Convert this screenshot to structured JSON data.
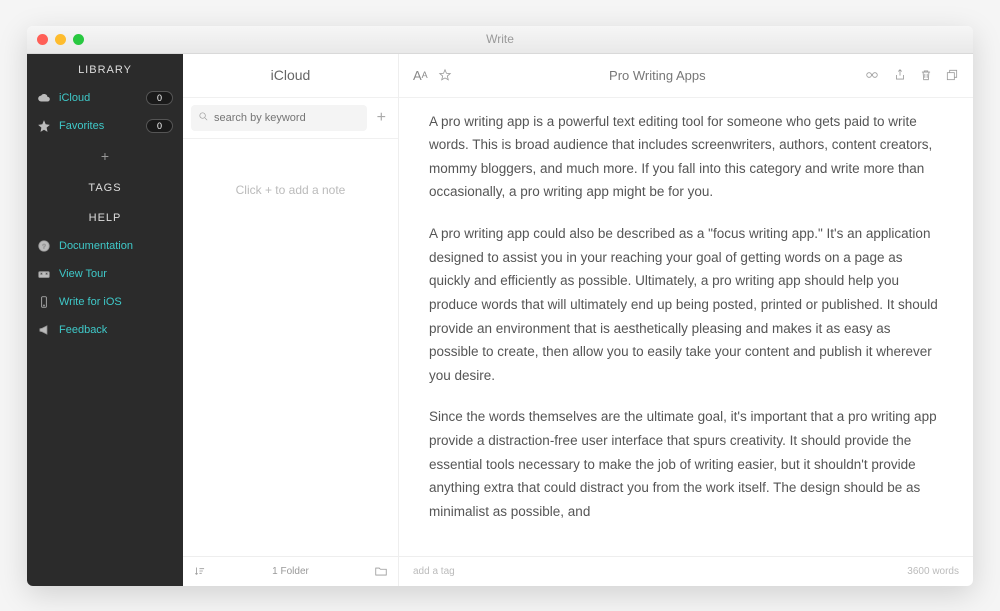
{
  "window": {
    "title": "Write"
  },
  "sidebar": {
    "header_library": "LIBRARY",
    "header_tags": "TAGS",
    "header_help": "HELP",
    "library_items": [
      {
        "icon": "cloud",
        "label": "iCloud",
        "count": "0",
        "teal": true
      },
      {
        "icon": "star",
        "label": "Favorites",
        "count": "0",
        "teal": true
      }
    ],
    "help_items": [
      {
        "icon": "question",
        "label": "Documentation"
      },
      {
        "icon": "tour",
        "label": "View Tour"
      },
      {
        "icon": "phone",
        "label": "Write for iOS"
      },
      {
        "icon": "megaphone",
        "label": "Feedback"
      }
    ]
  },
  "notes": {
    "title": "iCloud",
    "search_placeholder": "search by keyword",
    "empty_text": "Click + to add a note",
    "footer_text": "1 Folder"
  },
  "editor": {
    "title": "Pro Writing Apps",
    "paragraphs": [
      "A pro writing app is a powerful text editing tool for someone who gets paid to write words. This is broad audience that includes screenwriters, authors, content creators, mommy bloggers, and much more. If you fall into this category and write more than occasionally, a pro writing app might be for you.",
      "A pro writing app could also be described as a \"focus writing app.\" It's an application designed to assist you in your reaching your goal of getting words on a page as quickly and efficiently as possible. Ultimately, a pro writing app should help you produce words that will ultimately end up being posted, printed or published. It should provide an environment that is aesthetically pleasing and makes it as easy as possible to create, then allow you to easily take your content and publish it wherever you desire.",
      "Since the words themselves are the ultimate goal, it's important that a pro writing app provide a distraction-free user interface that spurs creativity. It should provide the essential tools necessary to make the job of writing easier, but it shouldn't provide anything extra that could distract you from the work itself. The design should be as minimalist as possible, and"
    ],
    "tag_placeholder": "add a tag",
    "word_count": "3600 words"
  }
}
